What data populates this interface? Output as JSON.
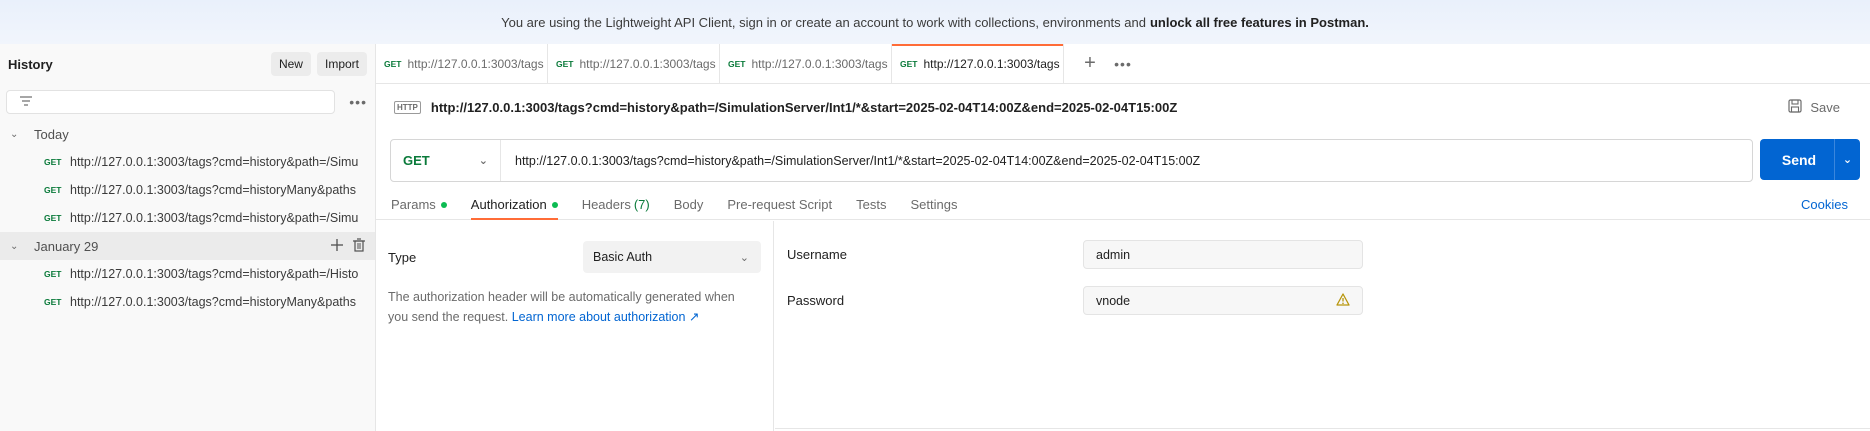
{
  "banner": {
    "text": "You are using the Lightweight API Client, sign in or create an account to work with collections, environments and",
    "bold": "unlock all free features in Postman."
  },
  "sidebar": {
    "title": "History",
    "new_label": "New",
    "import_label": "Import",
    "filter_icon": "filter-icon",
    "groups": [
      {
        "label": "Today",
        "items": [
          {
            "method": "GET",
            "url": "http://127.0.0.1:3003/tags?cmd=history&path=/Simu"
          },
          {
            "method": "GET",
            "url": "http://127.0.0.1:3003/tags?cmd=historyMany&paths"
          },
          {
            "method": "GET",
            "url": "http://127.0.0.1:3003/tags?cmd=history&path=/Simu"
          }
        ]
      },
      {
        "label": "January 29",
        "items": [
          {
            "method": "GET",
            "url": "http://127.0.0.1:3003/tags?cmd=history&path=/Histo"
          },
          {
            "method": "GET",
            "url": "http://127.0.0.1:3003/tags?cmd=historyMany&paths"
          }
        ]
      }
    ]
  },
  "tabs": [
    {
      "method": "GET",
      "label": "http://127.0.0.1:3003/tags"
    },
    {
      "method": "GET",
      "label": "http://127.0.0.1:3003/tags"
    },
    {
      "method": "GET",
      "label": "http://127.0.0.1:3003/tags"
    },
    {
      "method": "GET",
      "label": "http://127.0.0.1:3003/tags"
    }
  ],
  "request": {
    "http_badge": "HTTP",
    "title": "http://127.0.0.1:3003/tags?cmd=history&path=/SimulationServer/Int1/*&start=2025-02-04T14:00Z&end=2025-02-04T15:00Z",
    "save_label": "Save",
    "method": "GET",
    "url": "http://127.0.0.1:3003/tags?cmd=history&path=/SimulationServer/Int1/*&start=2025-02-04T14:00Z&end=2025-02-04T15:00Z",
    "send_label": "Send"
  },
  "subtabs": {
    "params": "Params",
    "authorization": "Authorization",
    "headers": "Headers",
    "headers_count": "(7)",
    "body": "Body",
    "prerequest": "Pre-request Script",
    "tests": "Tests",
    "settings": "Settings",
    "cookies": "Cookies"
  },
  "auth": {
    "type_label": "Type",
    "type_value": "Basic Auth",
    "description": "The authorization header will be automatically generated when you send the request.",
    "learn_more": "Learn more about authorization ↗",
    "username_label": "Username",
    "username_value": "admin",
    "password_label": "Password",
    "password_value": "vnode"
  },
  "colors": {
    "accent_orange": "#ff6c37",
    "send_blue": "#0265d2",
    "get_green": "#0a7a3a",
    "warning": "#b7950b"
  }
}
